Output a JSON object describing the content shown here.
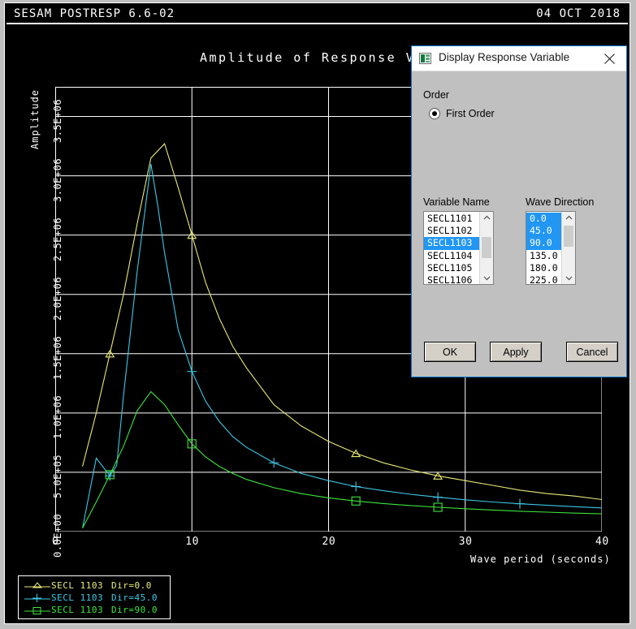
{
  "header": {
    "app_title": "SESAM POSTRESP 6.6-02",
    "date": "04 OCT 2018"
  },
  "chart_title": "Amplitude of Response Varia",
  "legend": {
    "rows": [
      {
        "name": "SECL 1103",
        "dir": "Dir=0.0",
        "color": "#e8e878",
        "marker": "triangle"
      },
      {
        "name": "SECL 1103",
        "dir": "Dir=45.0",
        "color": "#3cc8e6",
        "marker": "plus"
      },
      {
        "name": "SECL 1103",
        "dir": "Dir=90.0",
        "color": "#3ce63c",
        "marker": "square"
      }
    ]
  },
  "dialog": {
    "title": "Display Response Variable",
    "icon": "document-icon",
    "close_icon": "close-icon",
    "order_group_label": "Order",
    "order_option": "First Order",
    "variable_name_label": "Variable Name",
    "wave_direction_label": "Wave Direction",
    "variable_names": [
      "SECL1101",
      "SECL1102",
      "SECL1103",
      "SECL1104",
      "SECL1105",
      "SECL1106"
    ],
    "variable_selected": [
      "SECL1103"
    ],
    "wave_directions": [
      "0.0",
      "45.0",
      "90.0",
      "135.0",
      "180.0",
      "225.0"
    ],
    "wave_selected": [
      "0.0",
      "45.0",
      "90.0"
    ],
    "buttons": {
      "ok": "OK",
      "apply": "Apply",
      "cancel": "Cancel"
    }
  },
  "chart_data": {
    "type": "line",
    "title": "Amplitude of Response Variable",
    "xlabel": "Wave period (seconds)",
    "ylabel": "Amplitude",
    "xlim": [
      0,
      40
    ],
    "ylim": [
      0,
      3750000
    ],
    "xticks": [
      0,
      10,
      20,
      30,
      40
    ],
    "xtick_labels": [
      "0",
      "10",
      "20",
      "30",
      "40"
    ],
    "yticks": [
      0,
      500000,
      1000000,
      1500000,
      2000000,
      2500000,
      3000000,
      3500000
    ],
    "ytick_labels": [
      "0.0E+00",
      "5.0E+05",
      "1.0E+06",
      "1.5E+06",
      "2.0E+06",
      "2.5E+06",
      "3.0E+06",
      "3.5E+06"
    ],
    "grid": true,
    "legend_position": "below-left-outside",
    "series": [
      {
        "name": "SECL 1103 Dir=0.0",
        "color": "#e8e878",
        "marker": "triangle",
        "x": [
          2,
          3,
          4,
          5,
          6,
          7,
          8,
          9,
          10,
          11,
          12,
          13,
          14,
          16,
          18,
          20,
          22,
          24,
          26,
          28,
          30,
          32,
          34,
          36,
          38,
          40
        ],
        "y": [
          550000,
          1000000,
          1500000,
          2000000,
          2600000,
          3150000,
          3270000,
          2900000,
          2500000,
          2100000,
          1800000,
          1560000,
          1380000,
          1070000,
          890000,
          760000,
          660000,
          580000,
          520000,
          470000,
          430000,
          390000,
          350000,
          320000,
          300000,
          270000
        ],
        "marker_x": [
          4,
          10,
          22,
          28
        ],
        "marker_y": [
          1500000,
          2500000,
          660000,
          470000
        ]
      },
      {
        "name": "SECL 1103 Dir=45.0",
        "color": "#3cc8e6",
        "marker": "plus",
        "x": [
          2,
          3,
          4,
          4.5,
          5,
          6,
          7,
          7.5,
          8,
          9,
          10,
          11,
          12,
          13,
          14,
          16,
          18,
          20,
          22,
          24,
          26,
          28,
          30,
          32,
          34,
          36,
          38,
          40
        ],
        "y": [
          30000,
          620000,
          470000,
          560000,
          1150000,
          2200000,
          3100000,
          2750000,
          2350000,
          1700000,
          1350000,
          1100000,
          930000,
          800000,
          710000,
          580000,
          490000,
          430000,
          380000,
          345000,
          315000,
          290000,
          268000,
          250000,
          235000,
          222000,
          210000,
          200000
        ]
      },
      {
        "name": "SECL 1103 Dir=90.0",
        "color": "#3ce63c",
        "marker": "square",
        "x": [
          2,
          3,
          4,
          5,
          6,
          7,
          8,
          9,
          10,
          11,
          12,
          13,
          14,
          16,
          18,
          20,
          22,
          24,
          26,
          28,
          30,
          32,
          34,
          36,
          38,
          40
        ],
        "y": [
          30000,
          250000,
          480000,
          720000,
          1020000,
          1180000,
          1070000,
          900000,
          740000,
          630000,
          550000,
          490000,
          440000,
          370000,
          320000,
          285000,
          258000,
          237000,
          220000,
          205000,
          193000,
          182000,
          172000,
          164000,
          156000,
          150000
        ],
        "marker_x": [
          4,
          10,
          22,
          28
        ],
        "marker_y": [
          480000,
          740000,
          258000,
          205000
        ]
      }
    ]
  }
}
